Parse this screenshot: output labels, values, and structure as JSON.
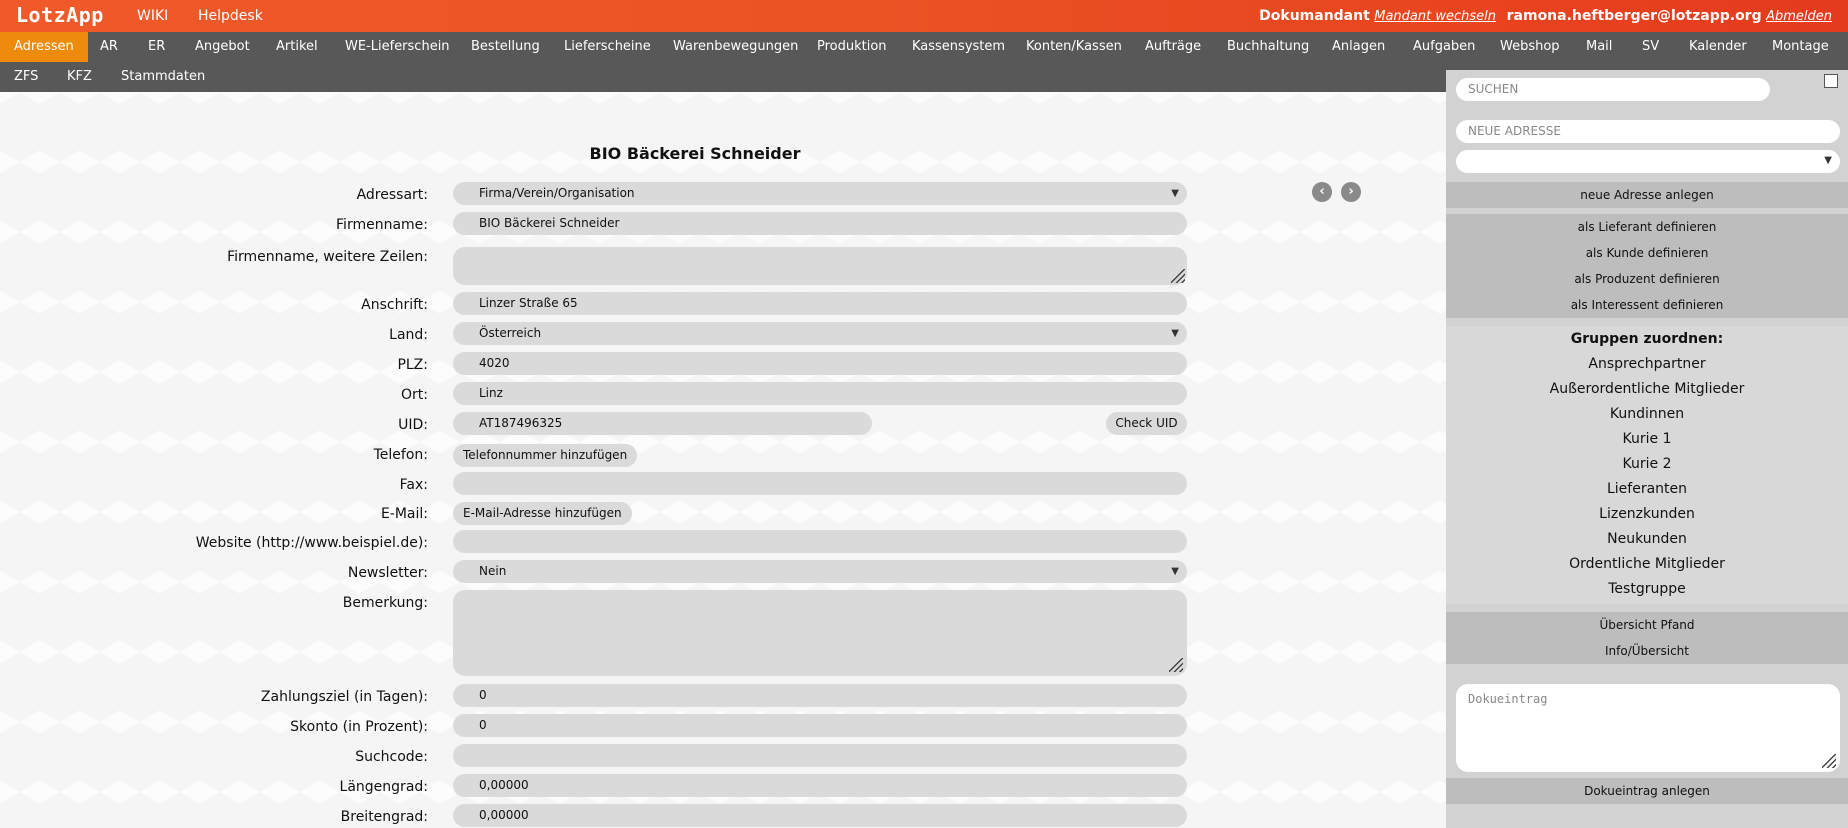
{
  "app": {
    "logo": "LotzApp"
  },
  "topnav": {
    "wiki": "WIKI",
    "helpdesk": "Helpdesk"
  },
  "mandant": {
    "name": "Dokumandant",
    "switch": "Mandant wechseln"
  },
  "user": {
    "email": "ramona.heftberger@lotzapp.org",
    "logout": "Abmelden"
  },
  "menu": {
    "row1": [
      "Adressen",
      "AR",
      "ER",
      "Angebot",
      "Artikel",
      "WE-Lieferschein",
      "Bestellung",
      "Lieferscheine",
      "Warenbewegungen",
      "Produktion",
      "Kassensystem",
      "Konten/Kassen",
      "Aufträge",
      "Buchhaltung",
      "Anlagen",
      "Aufgaben",
      "Webshop",
      "Mail",
      "SV",
      "Kalender",
      "Montage"
    ],
    "row2": [
      "ZFS",
      "KFZ",
      "Stammdaten"
    ],
    "active": "Adressen"
  },
  "form": {
    "title": "BIO Bäckerei Schneider",
    "labels": {
      "adressart": "Adressart:",
      "firmenname": "Firmenname:",
      "weitere": "Firmenname, weitere Zeilen:",
      "anschrift": "Anschrift:",
      "land": "Land:",
      "plz": "PLZ:",
      "ort": "Ort:",
      "uid": "UID:",
      "telefon": "Telefon:",
      "fax": "Fax:",
      "email": "E-Mail:",
      "website": "Website (http://www.beispiel.de):",
      "newsletter": "Newsletter:",
      "bemerkung": "Bemerkung:",
      "zahlungsziel": "Zahlungsziel (in Tagen):",
      "skonto": "Skonto (in Prozent):",
      "suchcode": "Suchcode:",
      "laengengrad": "Längengrad:",
      "breitengrad": "Breitengrad:"
    },
    "values": {
      "adressart": "Firma/Verein/Organisation",
      "firmenname": "BIO Bäckerei Schneider",
      "weitere": "",
      "anschrift": "Linzer Straße 65",
      "land": "Österreich",
      "plz": "4020",
      "ort": "Linz",
      "uid": "AT187496325",
      "fax": "",
      "website": "",
      "newsletter": "Nein",
      "bemerkung": "",
      "zahlungsziel": "0",
      "skonto": "0",
      "suchcode": "",
      "laengengrad": "0,00000",
      "breitengrad": "0,00000"
    },
    "buttons": {
      "check_uid": "Check UID",
      "add_phone": "Telefonnummer hinzufügen",
      "add_email": "E-Mail-Adresse hinzufügen"
    }
  },
  "sidebar": {
    "search_placeholder": "SUCHEN",
    "new_address_placeholder": "NEUE ADRESSE",
    "create_address": "neue Adresse anlegen",
    "define": [
      "als Lieferant definieren",
      "als Kunde definieren",
      "als Produzent definieren",
      "als Interessent definieren"
    ],
    "groups_title": "Gruppen zuordnen:",
    "groups": [
      "Ansprechpartner",
      "Außerordentliche Mitglieder",
      "Kundinnen",
      "Kurie 1",
      "Kurie 2",
      "Lieferanten",
      "Lizenzkunden",
      "Neukunden",
      "Ordentliche Mitglieder",
      "Testgruppe"
    ],
    "overview_pfand": "Übersicht Pfand",
    "info": "Info/Übersicht",
    "doc_placeholder": "Dokueintrag",
    "doc_create": "Dokueintrag anlegen"
  }
}
